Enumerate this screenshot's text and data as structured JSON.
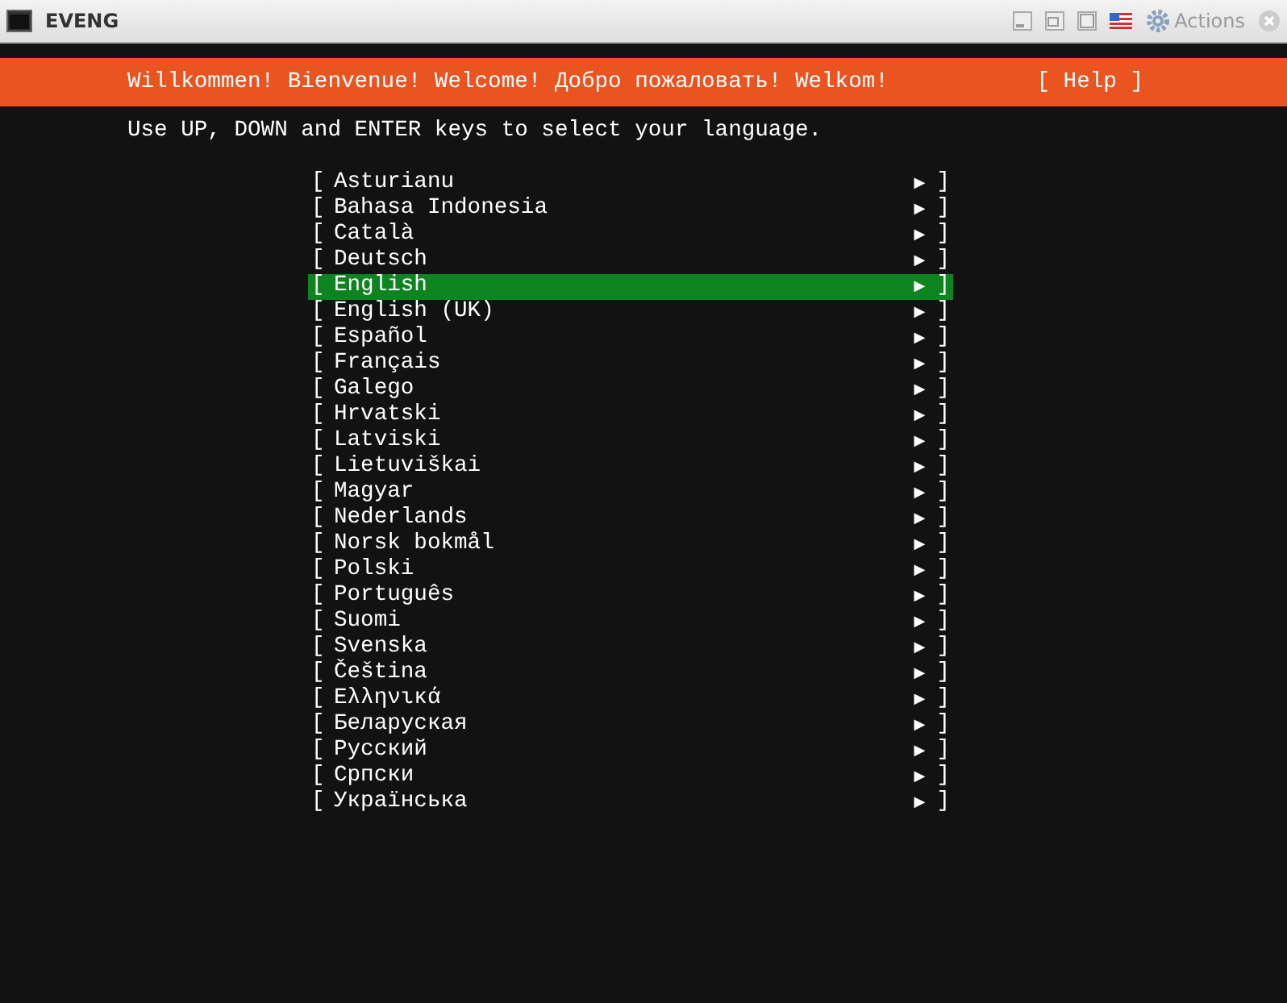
{
  "window": {
    "title": "EVENG",
    "actions": "Actions"
  },
  "header": {
    "title": "Willkommen! Bienvenue! Welcome! Добро пожаловать! Welkom!",
    "help": "[ Help ]"
  },
  "instructions": "Use UP, DOWN and ENTER keys to select your language.",
  "languages": [
    {
      "open": "[",
      "label": "Asturianu",
      "arrow": "▶",
      "close": "]",
      "selected": false
    },
    {
      "open": "[",
      "label": "Bahasa Indonesia",
      "arrow": "▶",
      "close": "]",
      "selected": false
    },
    {
      "open": "[",
      "label": "Català",
      "arrow": "▶",
      "close": "]",
      "selected": false
    },
    {
      "open": "[",
      "label": "Deutsch",
      "arrow": "▶",
      "close": "]",
      "selected": false
    },
    {
      "open": "[",
      "label": "English",
      "arrow": "▶",
      "close": "]",
      "selected": true
    },
    {
      "open": "[",
      "label": "English (UK)",
      "arrow": "▶",
      "close": "]",
      "selected": false
    },
    {
      "open": "[",
      "label": "Español",
      "arrow": "▶",
      "close": "]",
      "selected": false
    },
    {
      "open": "[",
      "label": "Français",
      "arrow": "▶",
      "close": "]",
      "selected": false
    },
    {
      "open": "[",
      "label": "Galego",
      "arrow": "▶",
      "close": "]",
      "selected": false
    },
    {
      "open": "[",
      "label": "Hrvatski",
      "arrow": "▶",
      "close": "]",
      "selected": false
    },
    {
      "open": "[",
      "label": "Latviski",
      "arrow": "▶",
      "close": "]",
      "selected": false
    },
    {
      "open": "[",
      "label": "Lietuviškai",
      "arrow": "▶",
      "close": "]",
      "selected": false
    },
    {
      "open": "[",
      "label": "Magyar",
      "arrow": "▶",
      "close": "]",
      "selected": false
    },
    {
      "open": "[",
      "label": "Nederlands",
      "arrow": "▶",
      "close": "]",
      "selected": false
    },
    {
      "open": "[",
      "label": "Norsk bokmål",
      "arrow": "▶",
      "close": "]",
      "selected": false
    },
    {
      "open": "[",
      "label": "Polski",
      "arrow": "▶",
      "close": "]",
      "selected": false
    },
    {
      "open": "[",
      "label": "Português",
      "arrow": "▶",
      "close": "]",
      "selected": false
    },
    {
      "open": "[",
      "label": "Suomi",
      "arrow": "▶",
      "close": "]",
      "selected": false
    },
    {
      "open": "[",
      "label": "Svenska",
      "arrow": "▶",
      "close": "]",
      "selected": false
    },
    {
      "open": "[",
      "label": "Čeština",
      "arrow": "▶",
      "close": "]",
      "selected": false
    },
    {
      "open": "[",
      "label": "Ελληνικά",
      "arrow": "▶",
      "close": "]",
      "selected": false
    },
    {
      "open": "[",
      "label": "Беларуская",
      "arrow": "▶",
      "close": "]",
      "selected": false
    },
    {
      "open": "[",
      "label": "Русский",
      "arrow": "▶",
      "close": "]",
      "selected": false
    },
    {
      "open": "[",
      "label": "Српски",
      "arrow": "▶",
      "close": "]",
      "selected": false
    },
    {
      "open": "[",
      "label": "Українська",
      "arrow": "▶",
      "close": "]",
      "selected": false
    }
  ]
}
